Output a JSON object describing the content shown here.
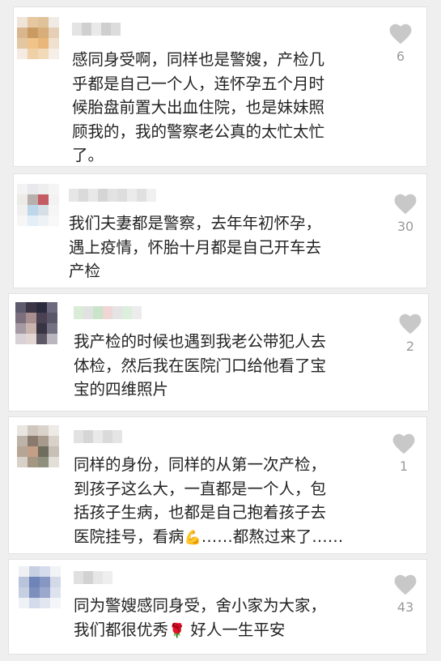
{
  "colors": {
    "background": "#efefef",
    "card": "#ffffff",
    "text": "#222222",
    "like_icon": "#c8c8c8",
    "like_count": "#9a9a9a"
  },
  "comments": [
    {
      "lines": [
        "感同身受啊，同样也是警嫂，产检几",
        "乎都是自己一个人，连怀孕五个月时",
        "候胎盘前置大出血住院，也是妹妹照",
        "顾我的，我的警察老公真的太忙太忙",
        "了。"
      ],
      "likes": "6",
      "like_icon": "heart-icon"
    },
    {
      "lines": [
        "我们夫妻都是警察，去年年初怀孕，",
        "遇上疫情，怀胎十月都是自己开车去",
        "产检"
      ],
      "likes": "30",
      "like_icon": "heart-icon"
    },
    {
      "lines": [
        "我产检的时候也遇到我老公带犯人去",
        "体检，然后我在医院门口给他看了宝",
        "宝的四维照片"
      ],
      "likes": "2",
      "like_icon": "heart-icon"
    },
    {
      "lines": [
        "同样的身份，同样的从第一次产检，",
        "到孩子这么大，一直都是一个人，包",
        "括孩子生病，也都是自己抱着孩子去"
      ],
      "line4_before": "医院挂号，看病",
      "line4_emoji": "💪",
      "line4_after": "……都熬过来了……",
      "likes": "1",
      "like_icon": "heart-icon"
    },
    {
      "line1": "同为警嫂感同身受，舍小家为大家，",
      "line2_before": "我们都很优秀",
      "line2_emoji": "🌹",
      "line2_after": " 好人一生平安",
      "likes": "43",
      "like_icon": "heart-icon"
    }
  ]
}
